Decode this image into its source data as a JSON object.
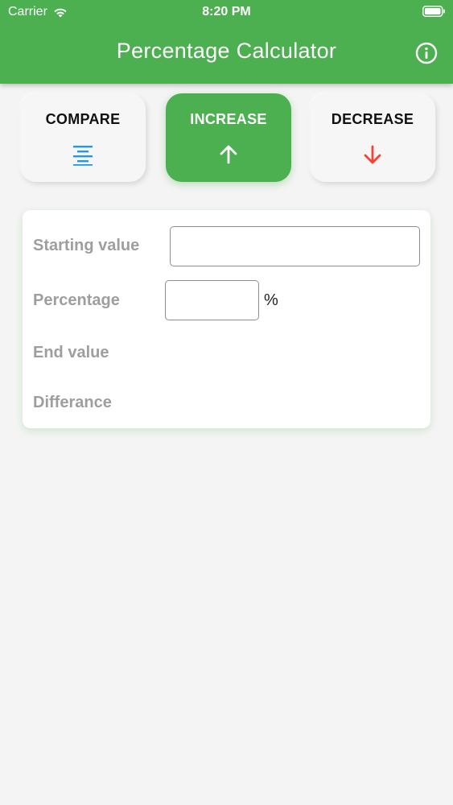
{
  "status_bar": {
    "carrier": "Carrier",
    "time": "8:20 PM"
  },
  "header": {
    "title": "Percentage Calculator",
    "info_icon": "info-circle-icon"
  },
  "colors": {
    "primary": "#4caf50",
    "compare_icon": "#2196f3",
    "decrease_icon": "#f44336",
    "label_gray": "#9e9e9e"
  },
  "modes": {
    "compare": {
      "label": "COMPARE",
      "icon": "align-center-icon"
    },
    "increase": {
      "label": "INCREASE",
      "icon": "arrow-up-icon",
      "selected": true
    },
    "decrease": {
      "label": "DECREASE",
      "icon": "arrow-down-icon"
    }
  },
  "form": {
    "starting_value": {
      "label": "Starting value",
      "value": ""
    },
    "percentage": {
      "label": "Percentage",
      "value": "",
      "unit": "%"
    },
    "end_value": {
      "label": "End value"
    },
    "difference": {
      "label": "Differance"
    }
  }
}
